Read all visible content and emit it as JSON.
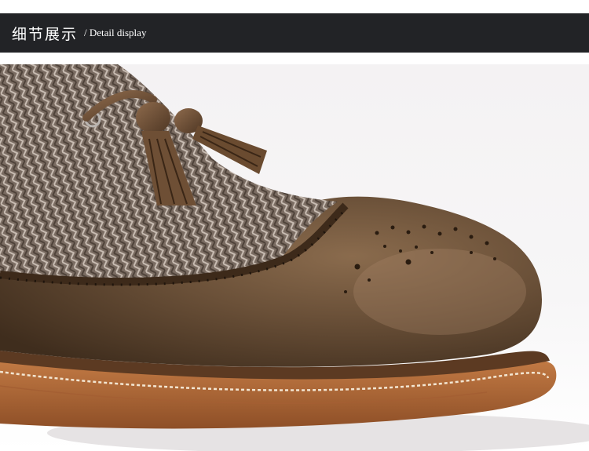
{
  "header": {
    "title_zh": "细节展示",
    "title_en": "/ Detail display"
  },
  "photo": {
    "subject": "tassel-wingtip-shoe-detail"
  },
  "colors": {
    "header_bg": "#222326",
    "header_text": "#ffffff",
    "leather": "#6b4f35",
    "sole": "#b06a3a"
  }
}
